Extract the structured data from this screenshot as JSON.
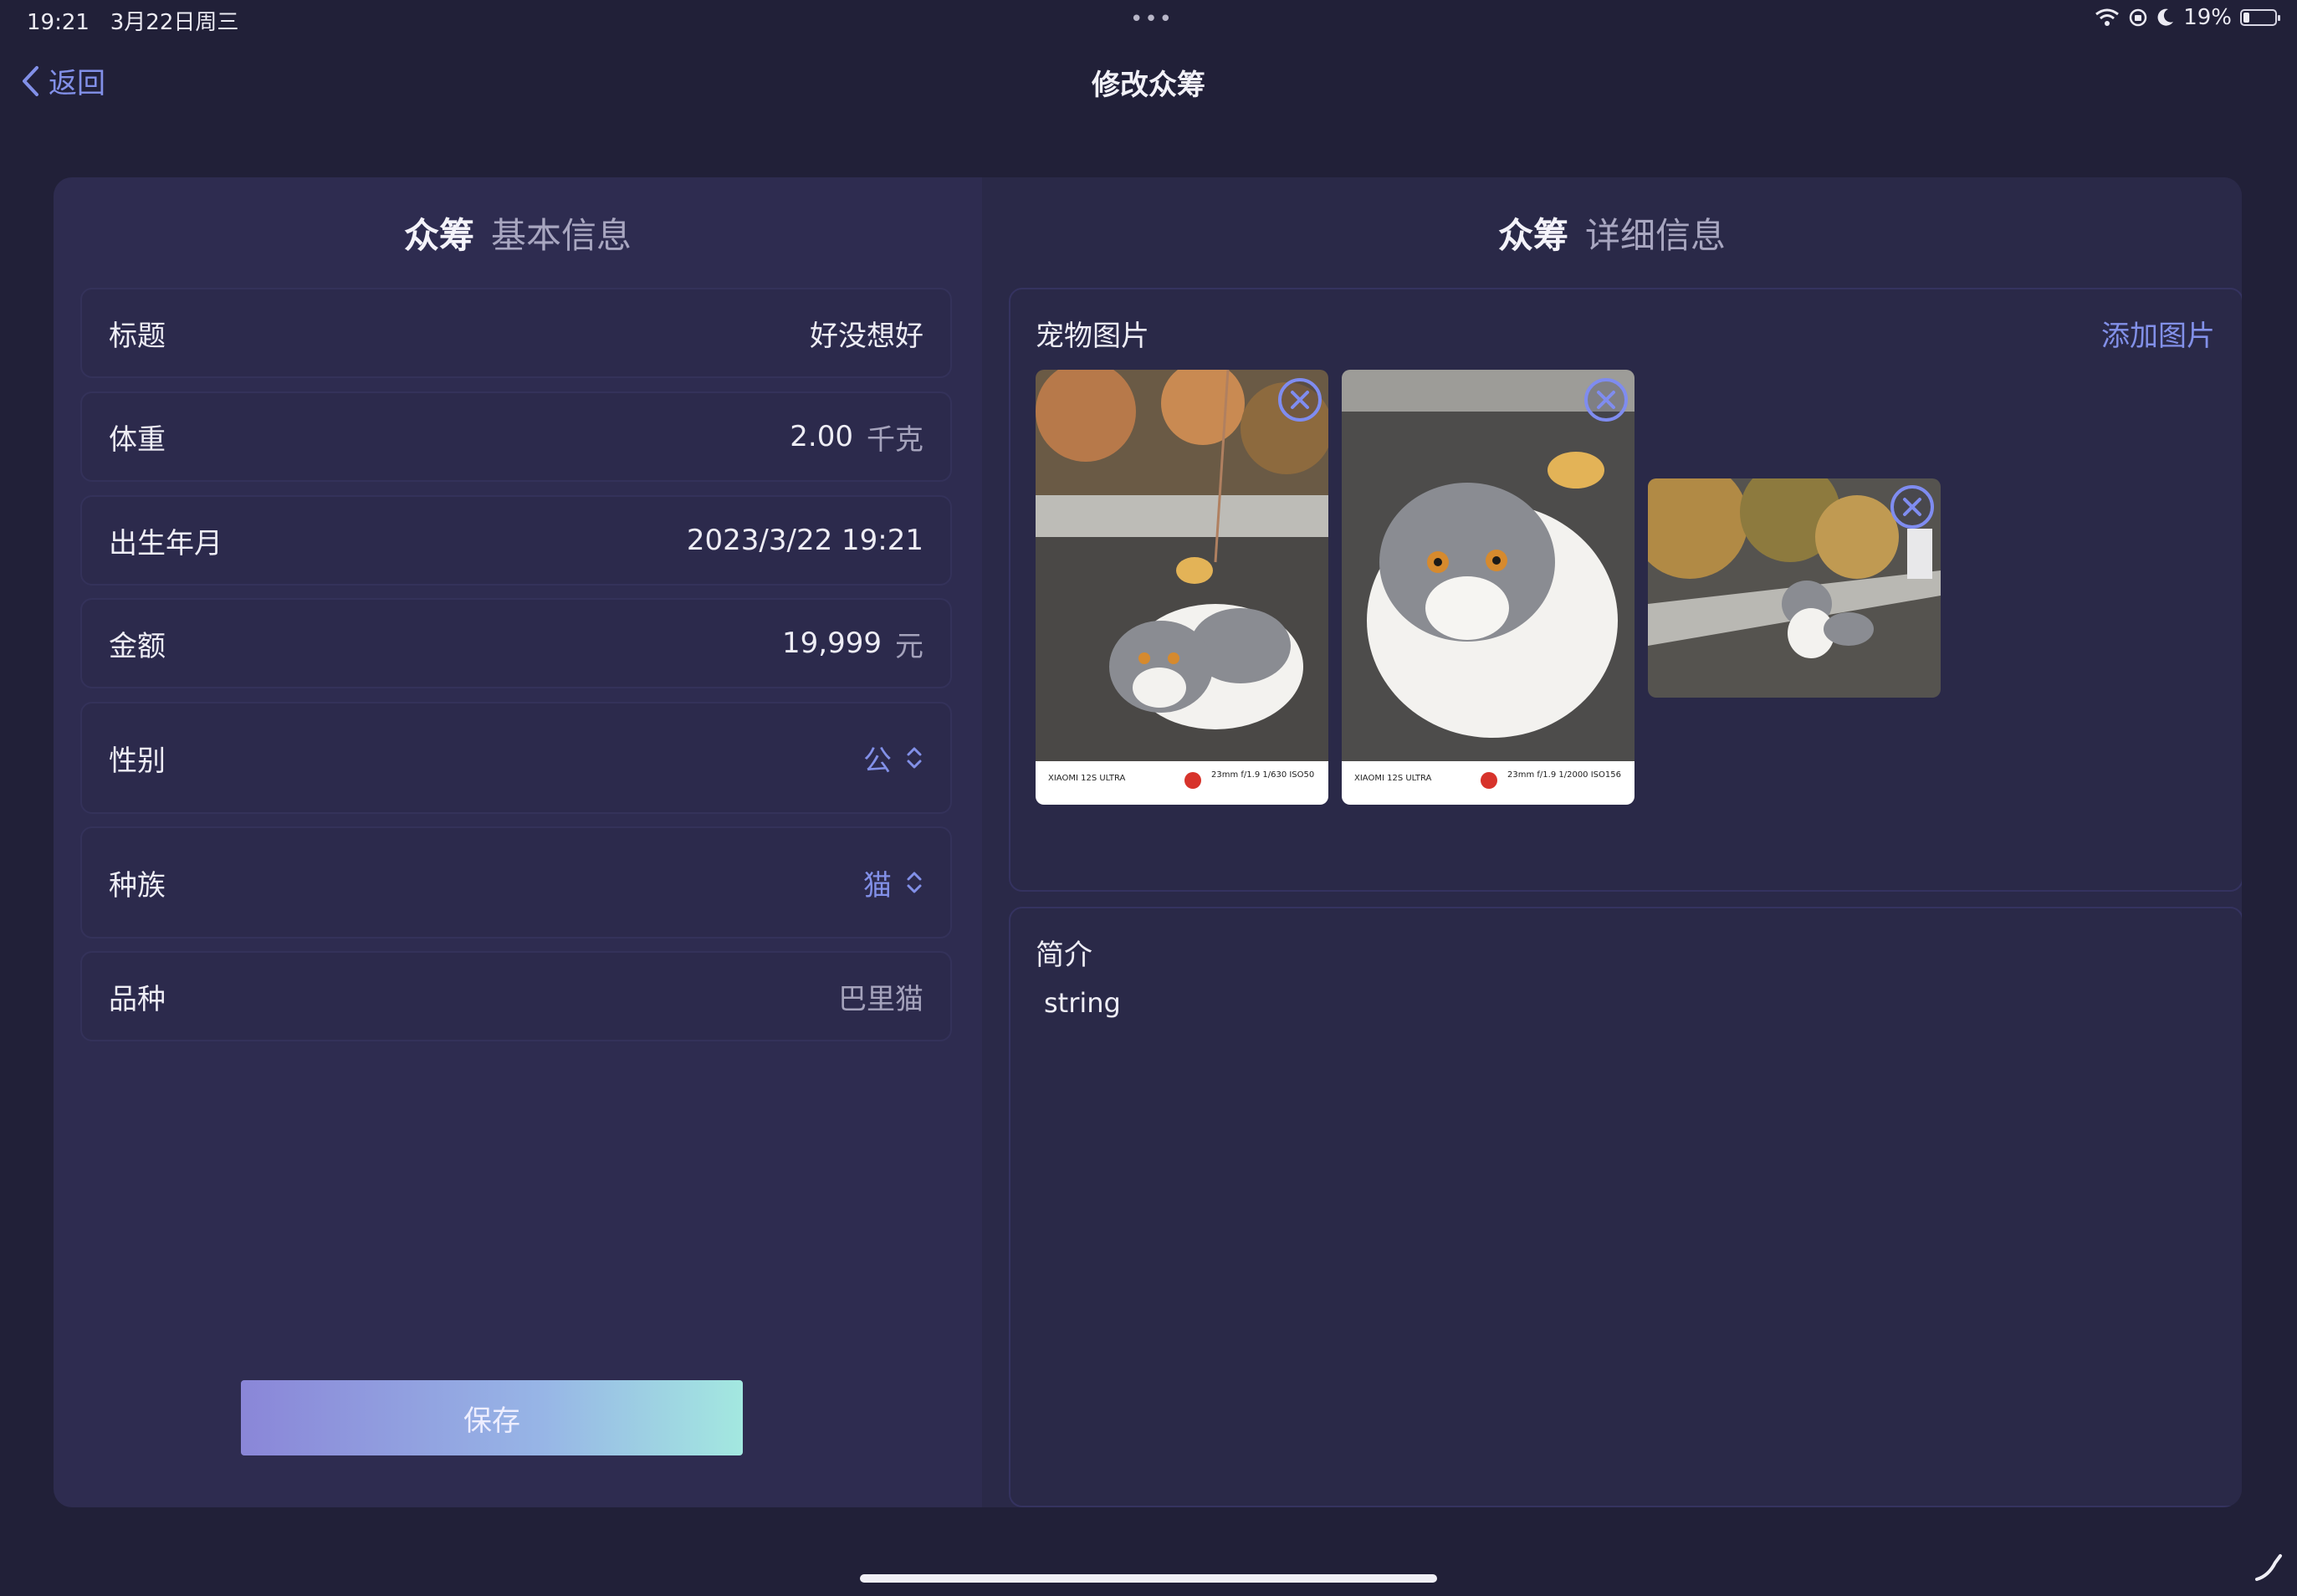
{
  "status": {
    "time": "19:21",
    "date": "3月22日周三",
    "dots": "•••",
    "battery": "19%",
    "battery_level": 0.19
  },
  "nav": {
    "back_label": "返回",
    "title": "修改众筹"
  },
  "left": {
    "heading_strong": "众筹",
    "heading": "基本信息",
    "fields": [
      {
        "label": "标题",
        "value": "好没想好"
      },
      {
        "label": "体重",
        "value": "2.00",
        "unit": "千克"
      },
      {
        "label": "出生年月",
        "value": "2023/3/22 19:21"
      },
      {
        "label": "金额",
        "value": "19,999",
        "unit": "元"
      },
      {
        "label": "性别",
        "value": "公"
      },
      {
        "label": "种族",
        "value": "猫"
      },
      {
        "label": "品种",
        "value": "巴里猫"
      }
    ],
    "save_label": "保存"
  },
  "right": {
    "heading_strong": "众筹",
    "heading": "详细信息",
    "photos": {
      "label": "宠物图片",
      "add_label": "添加图片",
      "items": [
        {
          "caption_model": "XIAOMI 12S ULTRA",
          "caption_exif": "23mm  f/1.9  1/630  ISO50"
        },
        {
          "caption_model": "XIAOMI 12S ULTRA",
          "caption_exif": "23mm  f/1.9  1/2000  ISO156"
        },
        {}
      ]
    },
    "intro": {
      "label": "简介",
      "text": "string"
    }
  },
  "colors": {
    "background": "#212038",
    "card": "#2e2c50",
    "accent": "#8290e8"
  }
}
